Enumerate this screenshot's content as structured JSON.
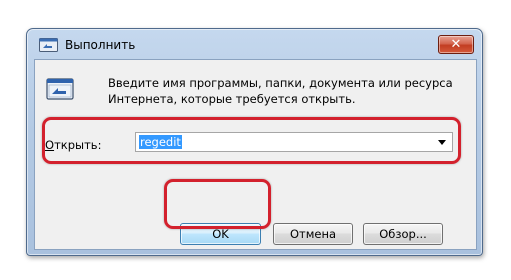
{
  "dialog": {
    "title": "Выполнить",
    "close_symbol": "✕",
    "description": "Введите имя программы, папки, документа или ресурса Интернета, которые требуется открыть.",
    "open_label_underlined": "О",
    "open_label_rest": "ткрыть:",
    "open_value": "regedit"
  },
  "buttons": {
    "ok": "OK",
    "cancel": "Отмена",
    "browse": "Обзор..."
  },
  "icons": {
    "title": "run-icon",
    "body": "run-icon",
    "close": "close-icon",
    "dropdown": "chevron-down-icon"
  },
  "colors": {
    "highlight": "#d3212d",
    "selection": "#3399ff"
  }
}
